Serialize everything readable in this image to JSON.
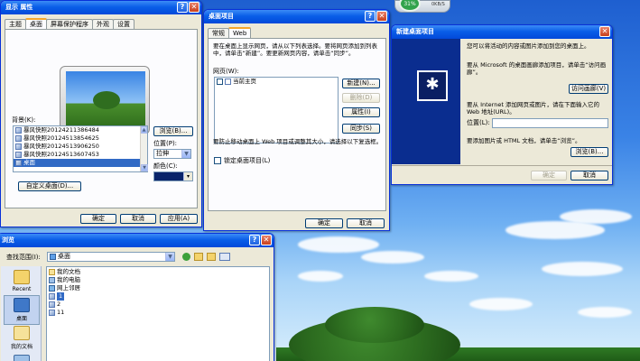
{
  "gadget": {
    "percent": "31%",
    "readout": "0KB/S"
  },
  "display_props": {
    "title": "显示 属性",
    "tabs": [
      "主题",
      "桌面",
      "屏幕保护程序",
      "外观",
      "设置"
    ],
    "active_tab": 1,
    "background_label": "背景(K):",
    "backgrounds": [
      "暴风快照20124211386484",
      "暴风快照20124513854625",
      "暴风快照20124513906250",
      "暴风快照20124513607453",
      "桌面"
    ],
    "selected_background": 4,
    "browse_button": "浏览(B)...",
    "position_label": "位置(P):",
    "position_value": "拉伸",
    "color_label": "颜色(C):",
    "customize_button": "自定义桌面(D)...",
    "ok": "确定",
    "cancel": "取消",
    "apply": "应用(A)"
  },
  "desktop_items": {
    "title": "桌面项目",
    "tabs": [
      "常规",
      "Web"
    ],
    "active_tab": 1,
    "description": "要在桌面上显示网页，请从以下列表选择。要将网页添加到列表中，请单击“新建”。要更新网页内容，请单击“同步”。",
    "webpages_label": "网页(W):",
    "webpages": [
      "当前主页"
    ],
    "new_button": "新建(N)...",
    "delete_button": "删除(D)",
    "properties_button": "属性(I)",
    "sync_button": "同步(S)",
    "lock_hint": "要防止移动桌面上 Web 项目或调整其大小，请选择以下复选框。",
    "lock_label": "锁定桌面项目(L)",
    "ok": "确定",
    "cancel": "取消"
  },
  "new_item": {
    "title": "新建桌面项目",
    "line1": "您可以将活动的内容或图片添加到您的桌面上。",
    "gallery_text": "要从 Microsoft 的桌面画廊添加项目，请单击“访问画廊”。",
    "gallery_button": "访问画廊(V)",
    "url_text": "要从 Internet 添加网页或图片，请在下面输入它的 Web 地址(URL)。",
    "location_label": "位置(L):",
    "location_value": "",
    "html_text": "要添加图片或 HTML 文档，请单击“浏览”。",
    "browse_button": "浏览(B)...",
    "ok": "确定",
    "cancel": "取消"
  },
  "browse_dialog": {
    "title": "浏览",
    "lookin_label": "查找范围(I):",
    "lookin_value": "桌面",
    "places": [
      "Recent",
      "桌面",
      "我的文档"
    ],
    "selected_place": 1,
    "files": [
      {
        "name": "我的文档",
        "icon": "docs"
      },
      {
        "name": "我的电脑",
        "icon": "pc"
      },
      {
        "name": "网上邻居",
        "icon": "net"
      },
      {
        "name": "1",
        "icon": "bmp"
      },
      {
        "name": "2",
        "icon": "bmp"
      },
      {
        "name": "11",
        "icon": "bmp"
      }
    ],
    "selected_file": 3
  }
}
